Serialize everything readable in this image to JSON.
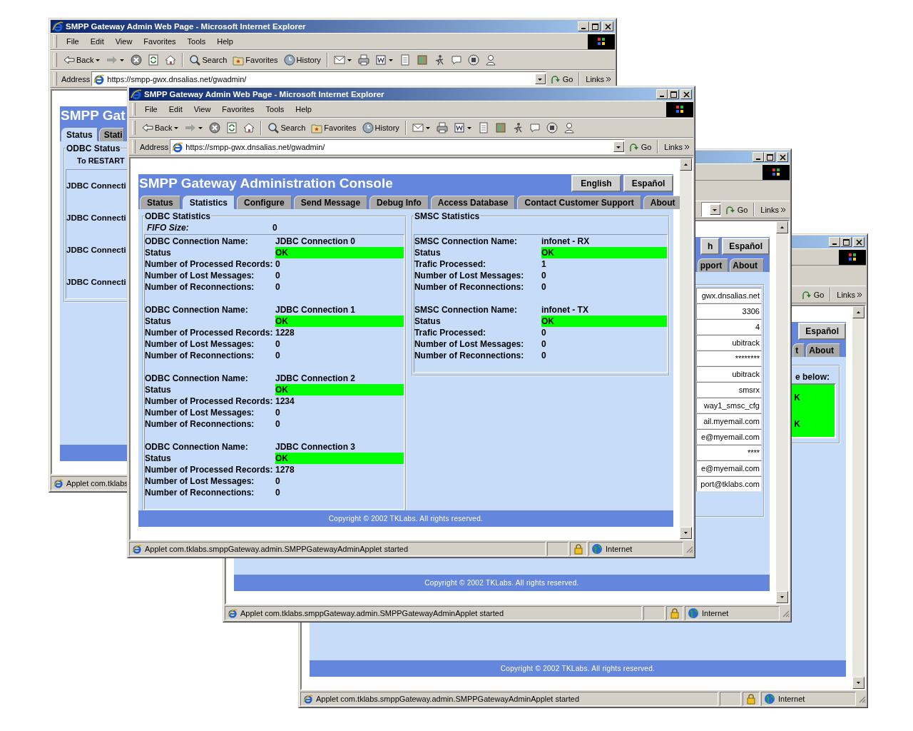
{
  "windows": [
    {
      "title": "SMPP Gateway Admin Web Page - Microsoft Internet Explorer",
      "menu": [
        "File",
        "Edit",
        "View",
        "Favorites",
        "Tools",
        "Help"
      ],
      "toolbar": {
        "back": "Back",
        "search": "Search",
        "favorites": "Favorites",
        "history": "History"
      },
      "address": {
        "label": "Address",
        "url": "https://smpp-gwx.dnsalias.net/gwadmin/",
        "go": "Go",
        "links": "Links"
      },
      "page": {
        "kind": "left_edge",
        "heading": "SMPP Gat",
        "tabs": [
          {
            "label": "Status",
            "selected": true
          },
          {
            "label": "Stati",
            "selected": false
          }
        ],
        "legend": "ODBC Status",
        "note": "To RESTART",
        "lines": [
          "JDBC Connecti",
          "JDBC Connecti",
          "JDBC Connecti",
          "JDBC Connecti"
        ]
      },
      "status": {
        "text": "Applet com.tklabs"
      }
    },
    {
      "title": "SMPP Gateway Admin Web Page - Microsoft Internet Explorer",
      "menu": [
        "File",
        "Edit",
        "View",
        "Favorites",
        "Tools",
        "Help"
      ],
      "toolbar": {
        "back": "Back",
        "search": "Search",
        "favorites": "Favorites",
        "history": "History"
      },
      "address": {
        "label": "Address",
        "url": "https://smpp-gwx.dnsalias.net/gwadmin/",
        "go": "Go",
        "links": "Links"
      },
      "page": {
        "kind": "statistics",
        "heading": "SMPP Gateway Administration Console",
        "buttons": [
          "English",
          "Español"
        ],
        "tabs": [
          {
            "label": "Status",
            "selected": false
          },
          {
            "label": "Statistics",
            "selected": true
          },
          {
            "label": "Configure",
            "selected": false
          },
          {
            "label": "Send Message",
            "selected": false
          },
          {
            "label": "Debug Info",
            "selected": false
          },
          {
            "label": "Access Database",
            "selected": false
          },
          {
            "label": "Contact Customer Support",
            "selected": false
          },
          {
            "label": "About",
            "selected": false
          }
        ],
        "odbc": {
          "legend": "ODBC Statistics",
          "fifo": {
            "label": "FIFO Size:",
            "value": "0"
          },
          "connections": [
            {
              "rows": [
                {
                  "kind": "text",
                  "label": "ODBC Connection Name:",
                  "value": "JDBC Connection 0"
                },
                {
                  "kind": "status",
                  "label": "Status",
                  "value": "OK",
                  "ok": true
                },
                {
                  "kind": "text",
                  "label": "Number of Processed Records:",
                  "value": "0"
                },
                {
                  "kind": "text",
                  "label": "Number of Lost Messages:",
                  "value": "0"
                },
                {
                  "kind": "text",
                  "label": "Number of Reconnections:",
                  "value": "0"
                }
              ]
            },
            {
              "rows": [
                {
                  "kind": "text",
                  "label": "ODBC Connection Name:",
                  "value": "JDBC Connection 1"
                },
                {
                  "kind": "status",
                  "label": "Status",
                  "value": "OK",
                  "ok": true
                },
                {
                  "kind": "text",
                  "label": "Number of Processed Records:",
                  "value": "1228"
                },
                {
                  "kind": "text",
                  "label": "Number of Lost Messages:",
                  "value": "0"
                },
                {
                  "kind": "text",
                  "label": "Number of Reconnections:",
                  "value": "0"
                }
              ]
            },
            {
              "rows": [
                {
                  "kind": "text",
                  "label": "ODBC Connection Name:",
                  "value": "JDBC Connection 2"
                },
                {
                  "kind": "status",
                  "label": "Status",
                  "value": "OK",
                  "ok": true
                },
                {
                  "kind": "text",
                  "label": "Number of Processed Records:",
                  "value": "1234"
                },
                {
                  "kind": "text",
                  "label": "Number of Lost Messages:",
                  "value": "0"
                },
                {
                  "kind": "text",
                  "label": "Number of Reconnections:",
                  "value": "0"
                }
              ]
            },
            {
              "rows": [
                {
                  "kind": "text",
                  "label": "ODBC Connection Name:",
                  "value": "JDBC Connection 3"
                },
                {
                  "kind": "status",
                  "label": "Status",
                  "value": "OK",
                  "ok": true
                },
                {
                  "kind": "text",
                  "label": "Number of Processed Records:",
                  "value": "1278"
                },
                {
                  "kind": "text",
                  "label": "Number of Lost Messages:",
                  "value": "0"
                },
                {
                  "kind": "text",
                  "label": "Number of Reconnections:",
                  "value": "0"
                }
              ]
            }
          ]
        },
        "smsc": {
          "legend": "SMSC Statistics",
          "connections": [
            {
              "rows": [
                {
                  "kind": "text",
                  "label": "SMSC Connection Name:",
                  "value": "infonet - RX"
                },
                {
                  "kind": "status",
                  "label": "Status",
                  "value": "OK",
                  "ok": true
                },
                {
                  "kind": "text",
                  "label": "Trafic Processed:",
                  "value": "1"
                },
                {
                  "kind": "text",
                  "label": "Number of Lost Messages:",
                  "value": "0"
                },
                {
                  "kind": "text",
                  "label": "Number of Reconnections:",
                  "value": "0"
                }
              ]
            },
            {
              "rows": [
                {
                  "kind": "text",
                  "label": "SMSC Connection Name:",
                  "value": "infonet - TX"
                },
                {
                  "kind": "status",
                  "label": "Status",
                  "value": "OK",
                  "ok": true
                },
                {
                  "kind": "text",
                  "label": "Trafic Processed:",
                  "value": "0"
                },
                {
                  "kind": "text",
                  "label": "Number of Lost Messages:",
                  "value": "0"
                },
                {
                  "kind": "text",
                  "label": "Number of Reconnections:",
                  "value": "0"
                }
              ]
            }
          ]
        },
        "footer": "Copyright © 2002 TKLabs. All rights reserved."
      },
      "status": {
        "text": "Applet com.tklabs.smppGateway.admin.SMPPGatewayAdminApplet started",
        "zone": "Internet"
      }
    },
    {
      "address": {
        "go": "Go",
        "links": "Links"
      },
      "page": {
        "kind": "right_edge_fields",
        "buttons": [
          "h",
          "Español"
        ],
        "tabs": [
          {
            "label": "pport",
            "selected": false
          },
          {
            "label": "About",
            "selected": false
          }
        ],
        "fields": [
          "gwx.dnsalias.net",
          "3306",
          "4",
          "ubitrack",
          "********",
          "ubitrack",
          "smsrx",
          "way1_smsc_cfg",
          "ail.myemail.com",
          "e@myemail.com",
          "****",
          "e@myemail.com",
          "port@tklabs.com"
        ],
        "footer": "Copyright © 2002 TKLabs. All rights reserved."
      },
      "status": {
        "text": "Applet com.tklabs.smppGateway.admin.SMPPGatewayAdminApplet started",
        "zone": "Internet"
      }
    },
    {
      "address": {
        "go": "Go",
        "links": "Links"
      },
      "page": {
        "kind": "right_edge_status",
        "buttons": [
          "Español"
        ],
        "tabs": [
          {
            "label": "t",
            "selected": false
          },
          {
            "label": "About",
            "selected": false
          }
        ],
        "prompt": "e below:",
        "ok": true,
        "lines": [
          "K",
          "K"
        ],
        "footer": "Copyright © 2002 TKLabs. All rights reserved."
      },
      "status": {
        "text": "Applet com.tklabs.smppGateway.admin.SMPPGatewayAdminApplet started",
        "zone": "Internet"
      }
    }
  ]
}
